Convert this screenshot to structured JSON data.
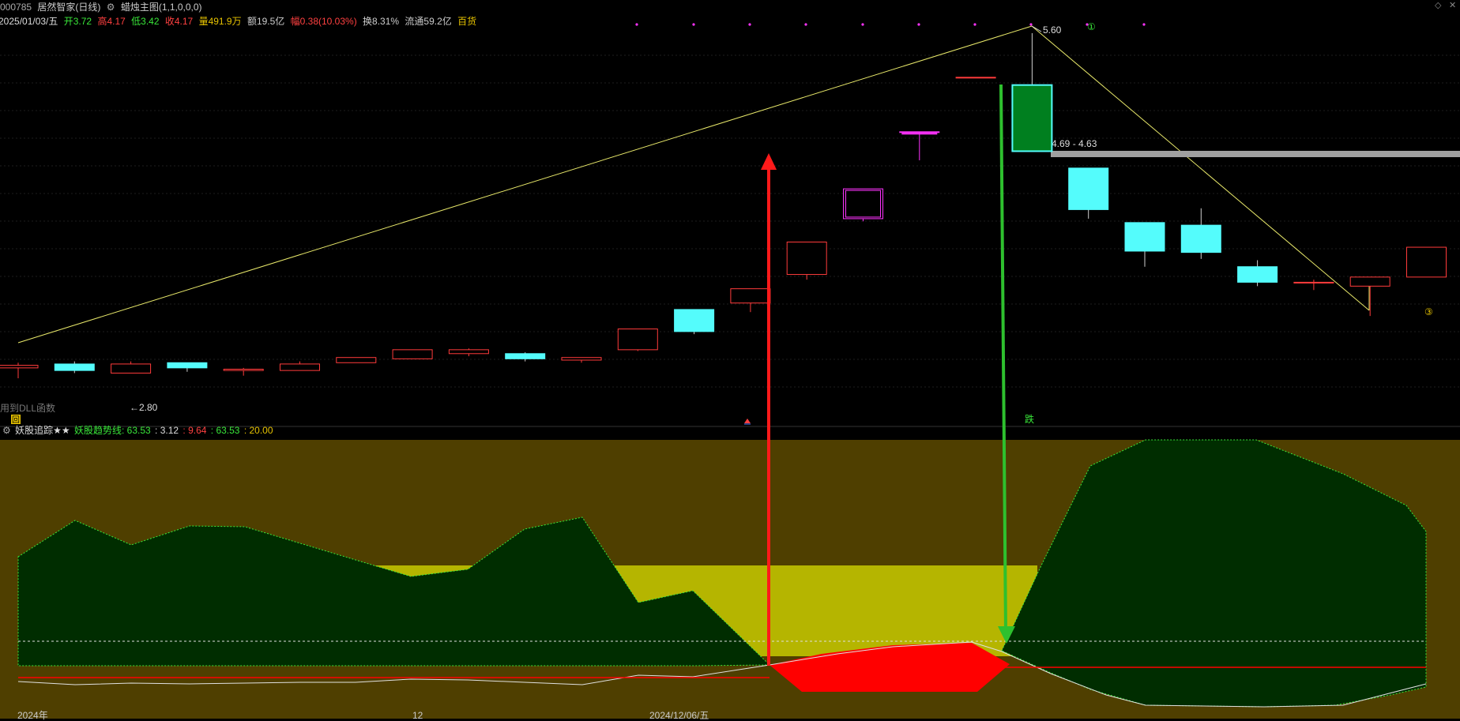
{
  "header": {
    "code": "000785",
    "name": "居然智家(日线)",
    "main_chart_indicator": "蜡烛主图(1,1,0,0,0)",
    "date": "2025/01/03/五",
    "open": "开3.72",
    "high": "高4.17",
    "low": "低3.42",
    "close": "收4.17",
    "volume": "量491.9万",
    "amount": "额19.5亿",
    "change": "幅0.38(10.03%)",
    "turnover": "换8.31%",
    "float_cap": "流通59.2亿",
    "sector_tag": "百货"
  },
  "main_chart": {
    "high_label": "5.60",
    "low_label": "←2.80",
    "gap_label": "4.69 - 4.63",
    "dll_label": "用到DLL函数",
    "drop_label": "跌",
    "circle_marker_top": "①",
    "circle_marker_right": "③",
    "square_marker": "回",
    "candles": [
      {
        "o": 3.02,
        "h": 3.06,
        "l": 2.94,
        "c": 3.04
      },
      {
        "o": 3.05,
        "h": 3.07,
        "l": 2.98,
        "c": 3.0
      },
      {
        "o": 2.98,
        "h": 3.07,
        "l": 2.98,
        "c": 3.05
      },
      {
        "o": 3.06,
        "h": 3.06,
        "l": 2.99,
        "c": 3.02
      },
      {
        "o": 3.0,
        "h": 3.02,
        "l": 2.96,
        "c": 3.01
      },
      {
        "o": 3.0,
        "h": 3.07,
        "l": 3.0,
        "c": 3.05
      },
      {
        "o": 3.06,
        "h": 3.1,
        "l": 3.06,
        "c": 3.1
      },
      {
        "o": 3.09,
        "h": 3.16,
        "l": 3.09,
        "c": 3.16
      },
      {
        "o": 3.13,
        "h": 3.17,
        "l": 3.11,
        "c": 3.16
      },
      {
        "o": 3.13,
        "h": 3.14,
        "l": 3.07,
        "c": 3.09
      },
      {
        "o": 3.08,
        "h": 3.1,
        "l": 3.06,
        "c": 3.1
      },
      {
        "o": 3.16,
        "h": 3.32,
        "l": 3.15,
        "c": 3.32
      },
      {
        "o": 3.47,
        "h": 3.47,
        "l": 3.28,
        "c": 3.3
      },
      {
        "o": 3.52,
        "h": 3.63,
        "l": 3.45,
        "c": 3.63
      },
      {
        "o": 3.74,
        "h": 3.99,
        "l": 3.7,
        "c": 3.99
      },
      {
        "o": 4.17,
        "h": 4.4,
        "l": 4.15,
        "c": 4.4
      },
      {
        "o": 4.84,
        "h": 4.84,
        "l": 4.62,
        "c": 4.84
      },
      {
        "o": 5.26,
        "h": 5.26,
        "l": 5.26,
        "c": 5.26
      },
      {
        "o": 5.2,
        "h": 5.6,
        "l": 4.69,
        "c": 4.69
      },
      {
        "o": 4.56,
        "h": 4.56,
        "l": 4.17,
        "c": 4.24
      },
      {
        "o": 4.14,
        "h": 4.14,
        "l": 3.8,
        "c": 3.92
      },
      {
        "o": 4.12,
        "h": 4.25,
        "l": 3.86,
        "c": 3.91
      },
      {
        "o": 3.8,
        "h": 3.85,
        "l": 3.65,
        "c": 3.68
      },
      {
        "o": 3.68,
        "h": 3.7,
        "l": 3.62,
        "c": 3.68
      },
      {
        "o": 3.65,
        "h": 3.72,
        "l": 3.42,
        "c": 3.72
      },
      {
        "o": 3.72,
        "h": 3.92,
        "l": 3.72,
        "c": 3.95
      }
    ]
  },
  "sub_chart": {
    "indicator_name": "妖股追踪★★",
    "line_label": "妖股趋势线: 63.53",
    "value1": ": 3.12",
    "value2": ": 9.64",
    "value3": ": 63.53",
    "value4": ": 20.00"
  },
  "time_axis": {
    "label1": "2024年",
    "label2": "12",
    "label3": "2024/12/06/五"
  },
  "colors": {
    "up": "#ff3b3b",
    "down": "#54fcfc",
    "limit_up": "#ff33ff",
    "big_down": "#007f1f",
    "trend_line": "#e8e86a",
    "panel_bg": "#4f3f00",
    "dark_green": "#002d00",
    "yellow_band": "#b5b500",
    "red_fill": "#ff0000"
  }
}
